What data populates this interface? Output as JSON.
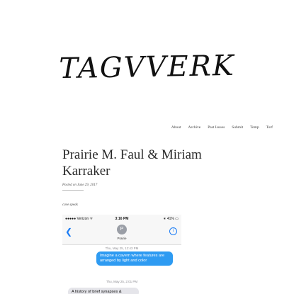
{
  "site": {
    "logo_text": "TAGVVERK"
  },
  "nav": {
    "items": [
      "About",
      "Archive",
      "Past Issues",
      "Submit",
      "Temp",
      "Torf"
    ]
  },
  "post": {
    "title": "Prairie M. Faul & Miriam Karraker",
    "meta": "Posted on June 29, 2017",
    "epigraph": "cave speak"
  },
  "phone": {
    "status": {
      "carrier": "●●●●● Verizon ᯤ",
      "time": "3:16 PM",
      "battery": "∗ 41% ▭"
    },
    "back_icon": "chevron-left-icon",
    "avatar_letter": "P",
    "contact_name": "Prairie",
    "info_icon": "i",
    "messages": [
      {
        "timestamp": "Thu, May 25, 12:43 PM",
        "text": "Imagine a cavern where features are arranged by light and color",
        "direction": "outgoing"
      },
      {
        "timestamp": "Thu, May 25, 2:01 PM",
        "text": "A history of brief synapses &",
        "direction": "incoming"
      }
    ],
    "colors": {
      "outgoing": "#2e9bf2",
      "incoming": "#e5e5ea",
      "accent": "#1a7cf5"
    }
  }
}
